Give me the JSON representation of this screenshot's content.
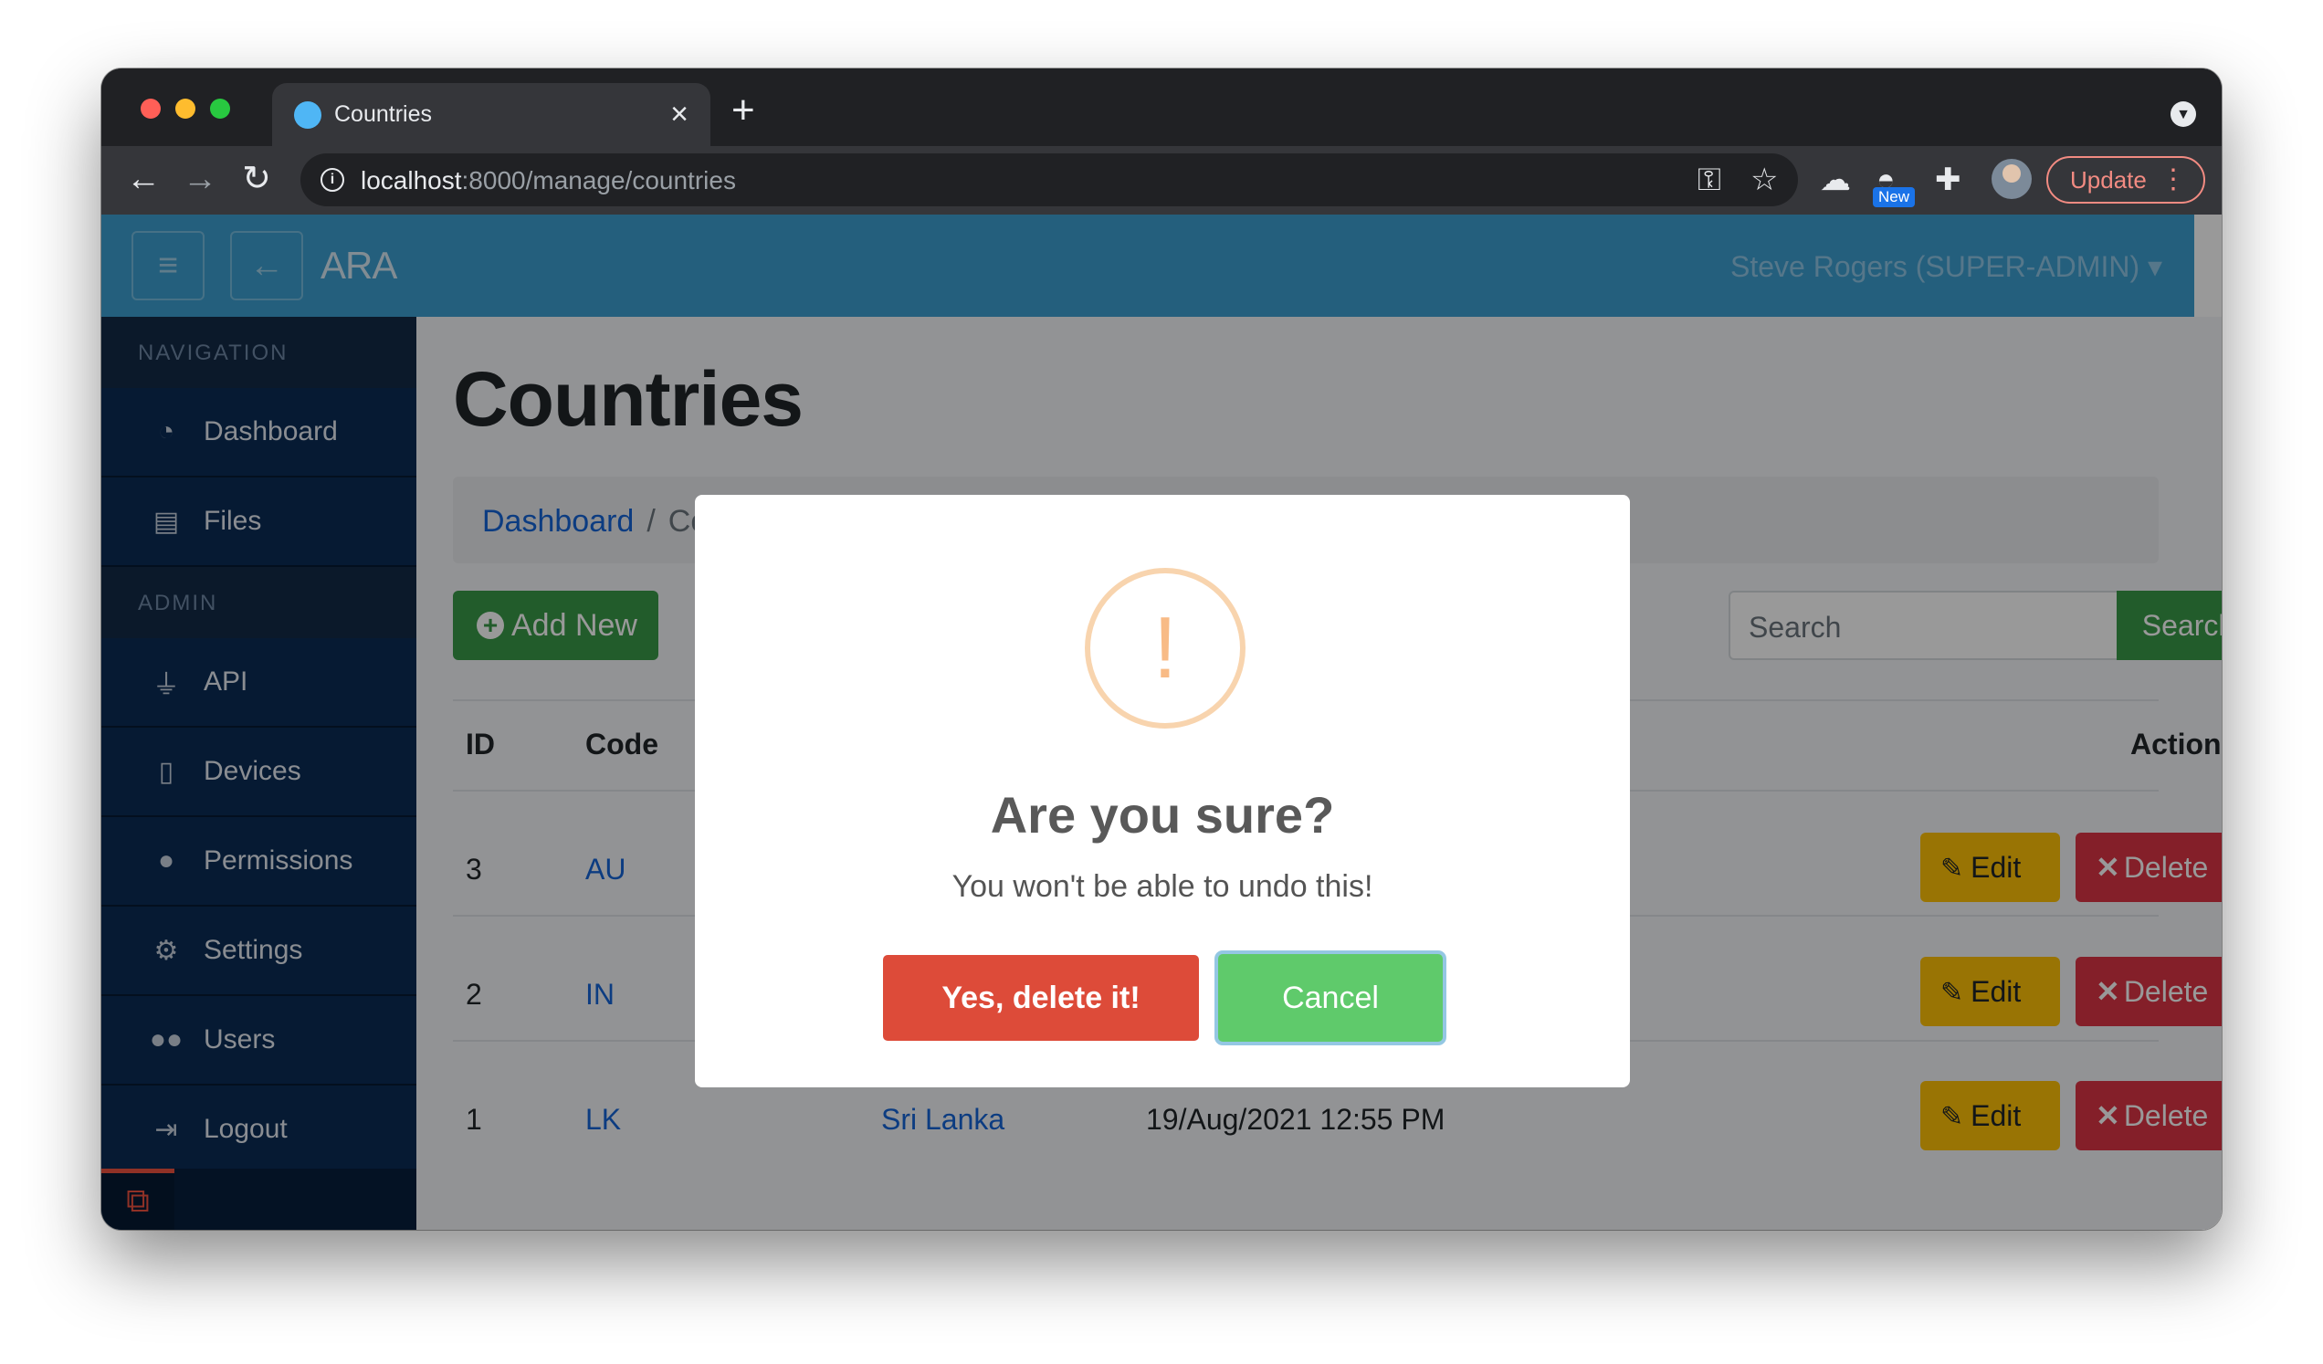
{
  "browser": {
    "tab_title": "Countries",
    "url_host": "localhost",
    "url_path": ":8000/manage/countries",
    "new_badge": "New",
    "update_label": "Update"
  },
  "app": {
    "brand": "ARA",
    "user": "Steve Rogers (SUPER-ADMIN)",
    "accent_color": "#3c9fd1"
  },
  "sidebar": {
    "section_navigation": "NAVIGATION",
    "section_admin": "ADMIN",
    "nav_items": [
      {
        "label": "Dashboard",
        "icon": "tachometer-icon"
      },
      {
        "label": "Files",
        "icon": "file-upload-icon"
      }
    ],
    "admin_items": [
      {
        "label": "API",
        "icon": "plug-icon"
      },
      {
        "label": "Devices",
        "icon": "mobile-icon"
      },
      {
        "label": "Permissions",
        "icon": "user-lock-icon"
      },
      {
        "label": "Settings",
        "icon": "cogs-icon"
      },
      {
        "label": "Users",
        "icon": "users-icon"
      },
      {
        "label": "Logout",
        "icon": "sign-out-icon"
      }
    ]
  },
  "page": {
    "title": "Countries",
    "breadcrumb": {
      "home": "Dashboard",
      "current": "Countries"
    },
    "add_new": "Add New",
    "search_placeholder": "Search",
    "search_button": "Search"
  },
  "table": {
    "headers": {
      "id": "ID",
      "code": "Code",
      "actions": "Actions"
    },
    "rows": [
      {
        "id": "3",
        "code": "AU"
      },
      {
        "id": "2",
        "code": "IN"
      },
      {
        "id": "1",
        "code": "LK",
        "name": "Sri Lanka",
        "created": "19/Aug/2021 12:55 PM"
      }
    ],
    "edit_label": "Edit",
    "delete_label": "Delete"
  },
  "modal": {
    "icon": "!",
    "title": "Are you sure?",
    "text": "You won't be able to undo this!",
    "confirm": "Yes, delete it!",
    "cancel": "Cancel",
    "confirm_color": "#dd4b39",
    "cancel_color": "#5fca6b"
  }
}
